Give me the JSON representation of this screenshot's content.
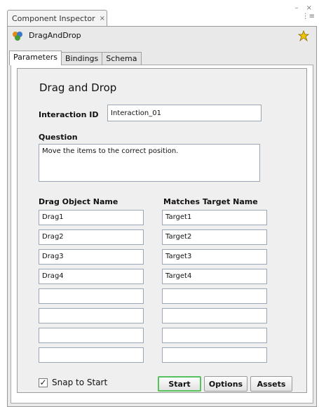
{
  "window": {
    "tab_title": "Component Inspector",
    "tab_close": "×",
    "controls": "– ×",
    "menu_glyph": "⋮≡"
  },
  "component": {
    "name": "DragAndDrop",
    "icon": "component-icon",
    "pin_icon": "pushpin-icon"
  },
  "tabs": [
    {
      "label": "Parameters",
      "active": true
    },
    {
      "label": "Bindings",
      "active": false
    },
    {
      "label": "Schema",
      "active": false
    }
  ],
  "form": {
    "heading": "Drag and Drop",
    "interaction_id_label": "Interaction ID",
    "interaction_id_value": "Interaction_01",
    "question_label": "Question",
    "question_value": "Move the items to the correct position.",
    "drag_header": "Drag Object Name",
    "target_header": "Matches Target Name",
    "drag_values": [
      "Drag1",
      "Drag2",
      "Drag3",
      "Drag4",
      "",
      "",
      "",
      ""
    ],
    "target_values": [
      "Target1",
      "Target2",
      "Target3",
      "Target4",
      "",
      "",
      "",
      ""
    ],
    "snap_label": "Snap to Start",
    "snap_checked": "✓"
  },
  "buttons": {
    "start": "Start",
    "options": "Options",
    "assets": "Assets"
  },
  "colors": {
    "active_button_border": "#56c25c",
    "field_border": "#9aa8b6"
  }
}
